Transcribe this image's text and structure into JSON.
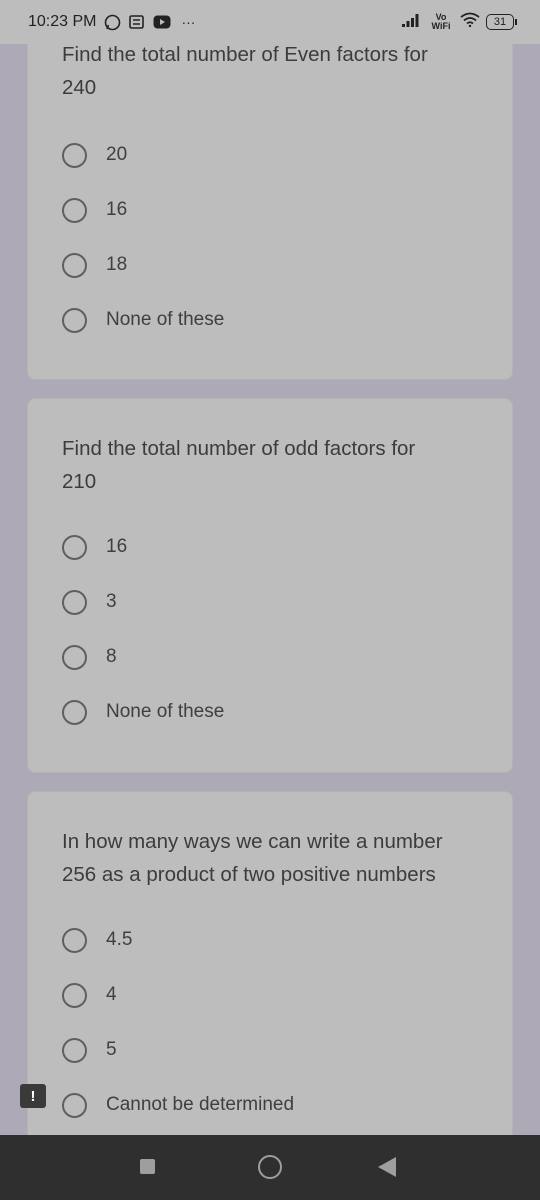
{
  "status": {
    "time": "10:23 PM",
    "network": "Vo WiFi",
    "battery": "31",
    "overflow": "···"
  },
  "questions": [
    {
      "line1": "Find the total number of Even factors for",
      "line2": "240",
      "options": [
        "20",
        "16",
        "18",
        "None of these"
      ]
    },
    {
      "line1": "Find the total number of odd factors for",
      "line2": "210",
      "options": [
        "16",
        "3",
        "8",
        "None of these"
      ]
    },
    {
      "line1": "In how many ways we can write a number",
      "line2": "256 as a product of two positive numbers",
      "options": [
        "4.5",
        "4",
        "5",
        "Cannot be determined"
      ]
    }
  ],
  "feedback": {
    "label": "!"
  },
  "colors": {
    "background": "#aea9b6",
    "card": "#bdbdbd",
    "nav_bar": "#2f2f2f"
  }
}
